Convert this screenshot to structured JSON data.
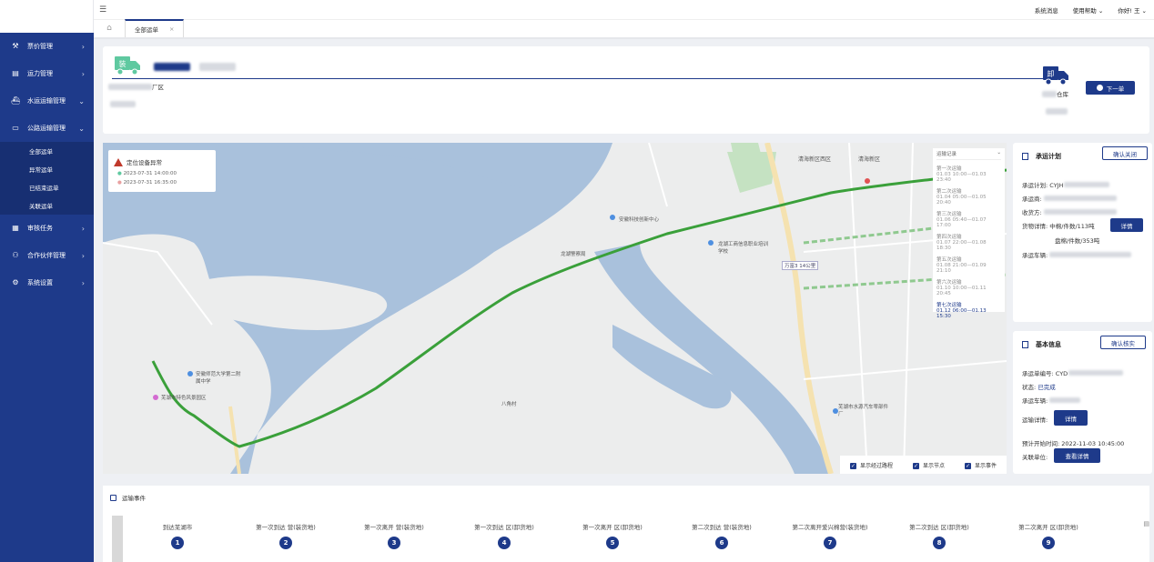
{
  "sidebar": {
    "items": [
      {
        "label": "票价管理",
        "icon": "gavel-icon"
      },
      {
        "label": "运力管理",
        "icon": "warehouse-icon"
      },
      {
        "label": "水运运输管理",
        "icon": "ship-icon"
      },
      {
        "label": "公路运输管理",
        "icon": "truck-icon"
      }
    ],
    "sub_items": [
      "全部运单",
      "异常运单",
      "已结束运单",
      "关联运单"
    ],
    "items2": [
      {
        "label": "审核任务",
        "icon": "clipboard-icon"
      },
      {
        "label": "合作伙伴管理",
        "icon": "users-icon"
      },
      {
        "label": "系统设置",
        "icon": "gear-icon"
      }
    ]
  },
  "topbar": {
    "messages": "系统消息",
    "help": "使用帮助",
    "user": "你好! 王"
  },
  "tabs": {
    "home_icon": "home-icon",
    "active": "全部运单"
  },
  "route": {
    "start_badge": "装",
    "end_badge": "卸",
    "start_place_suffix": "厂区",
    "end_place_suffix": "仓库",
    "next_button": "下一单"
  },
  "map": {
    "alert_title": "定位设备异常",
    "alert_times": [
      "2023-07-31 14:00:00",
      "2023-07-31 16:35:00"
    ],
    "labels": [
      "清海新区西区",
      "清海新区",
      "安徽科技创新中心",
      "龙湖工商信息职业培训学校",
      "芜湖市水源汽车零部件厂",
      "龙湖警察局",
      "八角村",
      "安徽师范大学第二附属中学",
      "芜湖市特色风景园区"
    ],
    "log": {
      "title": "运输记录",
      "entries": [
        {
          "t": "第一次运输",
          "d": "01.03 10:00—01.03 23:40"
        },
        {
          "t": "第二次运输",
          "d": "01.04 05:00—01.05 20:40"
        },
        {
          "t": "第三次运输",
          "d": "01.06 05:40—01.07 17:00"
        },
        {
          "t": "第四次运输",
          "d": "01.07 22:00—01.08 18:30"
        },
        {
          "t": "第五次运输",
          "d": "01.08 21:00—01.09 21:10"
        },
        {
          "t": "第六次运输",
          "d": "01.10 10:00—01.11 20:45"
        },
        {
          "t": "第七次运输",
          "d": "01.12 06:00—01.13 15:30"
        }
      ]
    },
    "options": [
      "显示经过路程",
      "显示节点",
      "显示事件"
    ],
    "badge": "万富3  14公里"
  },
  "plan": {
    "title": "承运计划",
    "confirm": "确认关闭",
    "rows": [
      {
        "k": "承运计划:",
        "v": "CYJH"
      },
      {
        "k": "承运商:",
        "v": ""
      },
      {
        "k": "收货方:",
        "v": ""
      },
      {
        "k": "货物详情:",
        "v": "中棉/件数/113吨"
      },
      {
        "k": "",
        "v": "盘棉/件数/353吨"
      },
      {
        "k": "承运车辆:",
        "v": ""
      }
    ],
    "detail_btn": "详情"
  },
  "basic": {
    "title": "基本信息",
    "confirm": "确认核实",
    "order_label": "承运单编号:",
    "order_value": "CYD",
    "status_label": "状态:",
    "status_value": "已完成",
    "vehicle_label": "承运车辆:",
    "transport_label": "运输详情:",
    "detail_btn": "详情",
    "start_label": "预计开始时间:",
    "start_value": "2022-11-03 10:45:00",
    "unit_label": "关联单位:",
    "unit_btn": "查看详情"
  },
  "events": {
    "title": "运输事件",
    "steps": [
      {
        "n": "1",
        "label": "到达芜湖市"
      },
      {
        "n": "2",
        "label": "第一次到达         营(装货地)"
      },
      {
        "n": "3",
        "label": "第一次离开         营(装货地)"
      },
      {
        "n": "4",
        "label": "第一次到达         区(卸货地)"
      },
      {
        "n": "5",
        "label": "第一次离开         区(卸货地)"
      },
      {
        "n": "6",
        "label": "第二次到达         营(装货地)"
      },
      {
        "n": "7",
        "label": "第二次离开爱兴棉营(装货地)"
      },
      {
        "n": "8",
        "label": "第二次到达         区(卸货地)"
      },
      {
        "n": "9",
        "label": "第二次离开         区(卸货地)"
      }
    ]
  },
  "colors": {
    "primary": "#1e3a8a",
    "route": "#3aa03a",
    "truck_start": "#5fc9a0",
    "truck_end": "#1e3a8a"
  }
}
